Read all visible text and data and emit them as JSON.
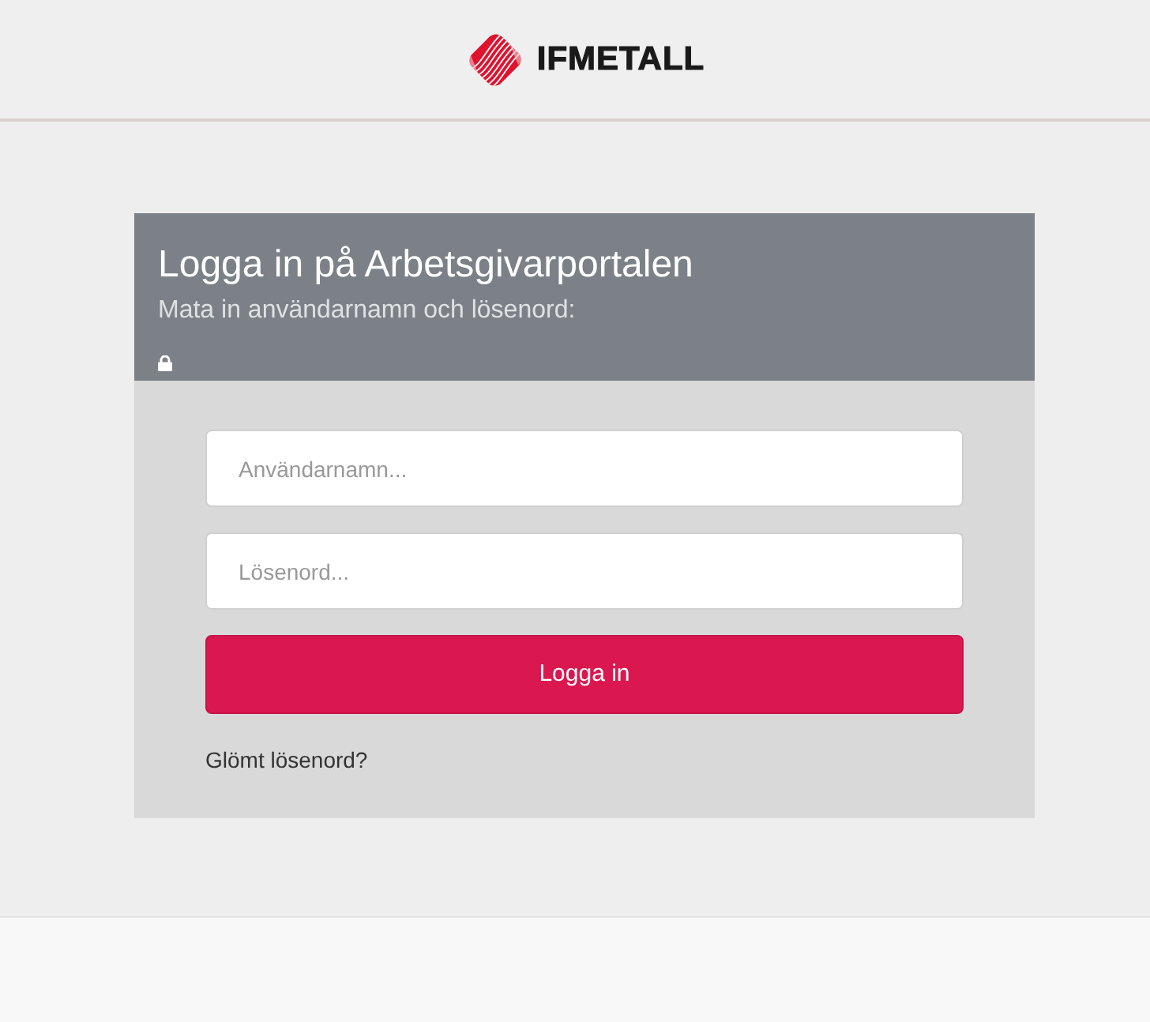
{
  "header": {
    "logo_text": "IFMETALL"
  },
  "login": {
    "title": "Logga in på Arbetsgivarportalen",
    "subtitle": "Mata in användarnamn och lösenord:",
    "fields": [
      {
        "placeholder": "Användarnamn..."
      },
      {
        "placeholder": "Lösenord..."
      }
    ],
    "submit": "Logga in",
    "forgot_link": "Glömt lösenord?"
  }
}
